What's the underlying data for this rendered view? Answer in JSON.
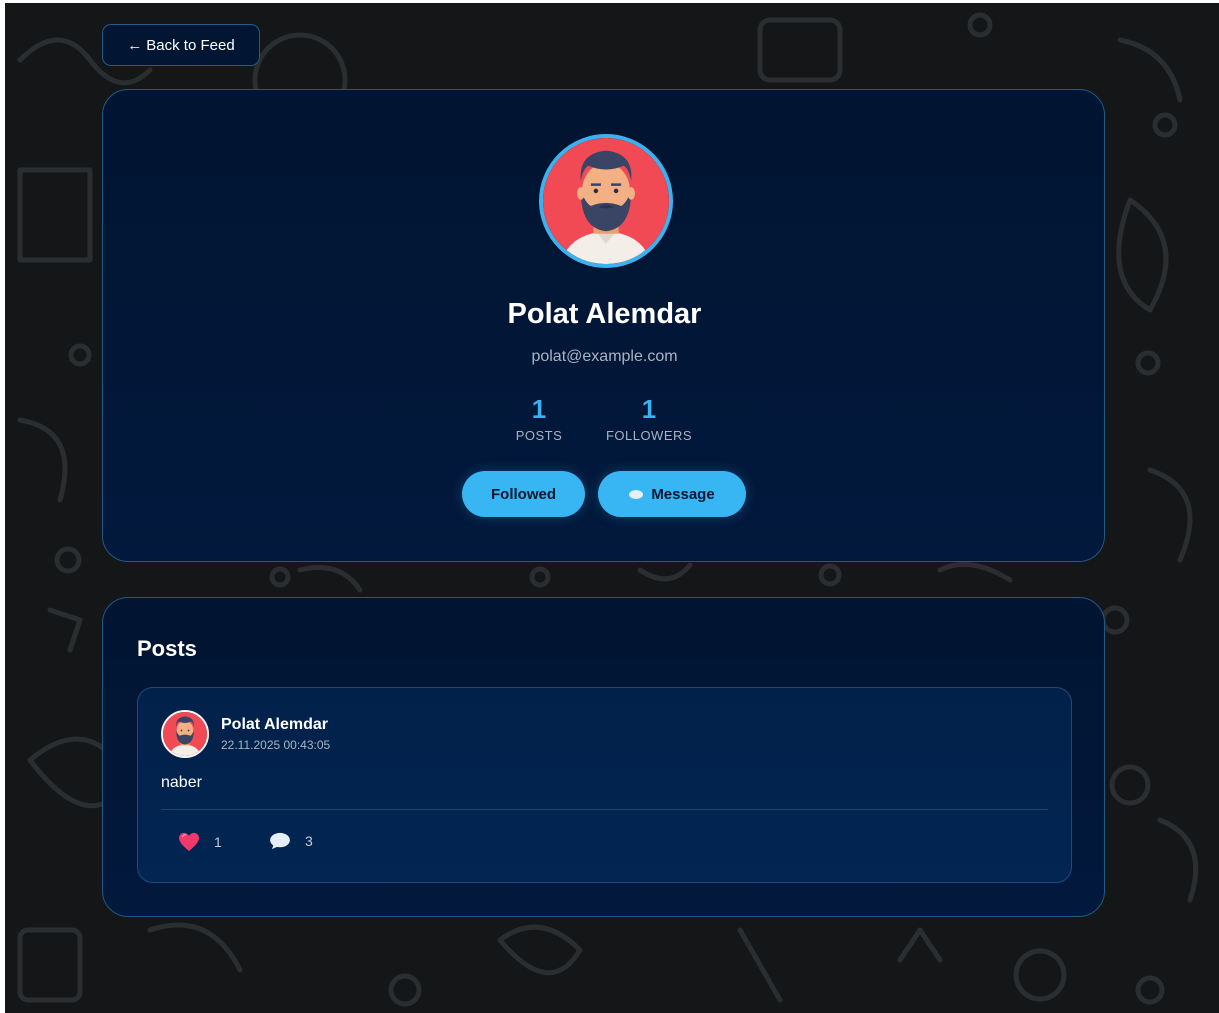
{
  "nav": {
    "back_label": "Back to Feed"
  },
  "profile": {
    "name": "Polat Alemdar",
    "email": "polat@example.com",
    "stats": [
      {
        "value": "1",
        "label": "POSTS"
      },
      {
        "value": "1",
        "label": "FOLLOWERS"
      }
    ],
    "follow_button_label": "Followed",
    "message_button_label": "Message"
  },
  "posts_section": {
    "title": "Posts",
    "items": [
      {
        "author": "Polat Alemdar",
        "timestamp": "22.11.2025 00:43:05",
        "content": "naber",
        "likes": "1",
        "comments": "3"
      }
    ]
  },
  "icons": {
    "back": "arrow-left-icon",
    "message": "speech-bubble-icon",
    "like": "heart-icon",
    "comment": "comment-bubble-icon"
  },
  "colors": {
    "accent": "#38b6f4",
    "card_bg": "#011431",
    "card_border": "#1e5a86",
    "page_bg": "#141617",
    "heart": "#f0386b"
  }
}
